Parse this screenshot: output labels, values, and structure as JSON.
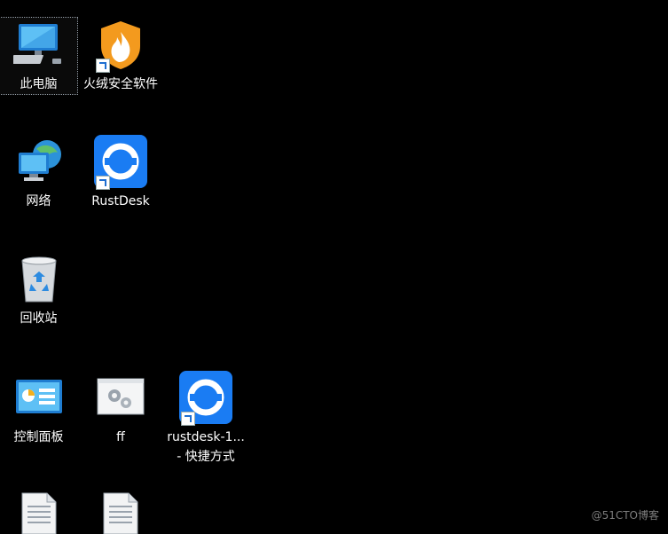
{
  "desktop": {
    "background": "#000000",
    "icons": [
      {
        "id": "this-pc",
        "label": "此电脑",
        "icon": "computer-icon",
        "selected": true
      },
      {
        "id": "huorong",
        "label": "火绒安全软件",
        "icon": "shield-flame-icon",
        "shortcut": true
      },
      {
        "id": "network",
        "label": "网络",
        "icon": "network-globe-icon"
      },
      {
        "id": "rustdesk",
        "label": "RustDesk",
        "icon": "rustdesk-icon",
        "shortcut": true
      },
      {
        "id": "recycle-bin",
        "label": "回收站",
        "icon": "recycle-bin-icon"
      },
      {
        "id": "control-panel",
        "label": "控制面板",
        "icon": "control-panel-icon"
      },
      {
        "id": "ff",
        "label": "ff",
        "icon": "settings-file-icon"
      },
      {
        "id": "rustdesk-shortcut",
        "label_line1": "rustdesk-1...",
        "label_line2": "- 快捷方式",
        "icon": "rustdesk-icon",
        "shortcut": true
      },
      {
        "id": "file-1",
        "label": "",
        "icon": "document-icon"
      },
      {
        "id": "file-2",
        "label": "",
        "icon": "document-icon"
      }
    ]
  },
  "watermark": "@51CTO博客",
  "colors": {
    "rustdesk_blue": "#1a7cf3",
    "shield_orange": "#f39a1e",
    "monitor_blue": "#3aa0ea"
  }
}
